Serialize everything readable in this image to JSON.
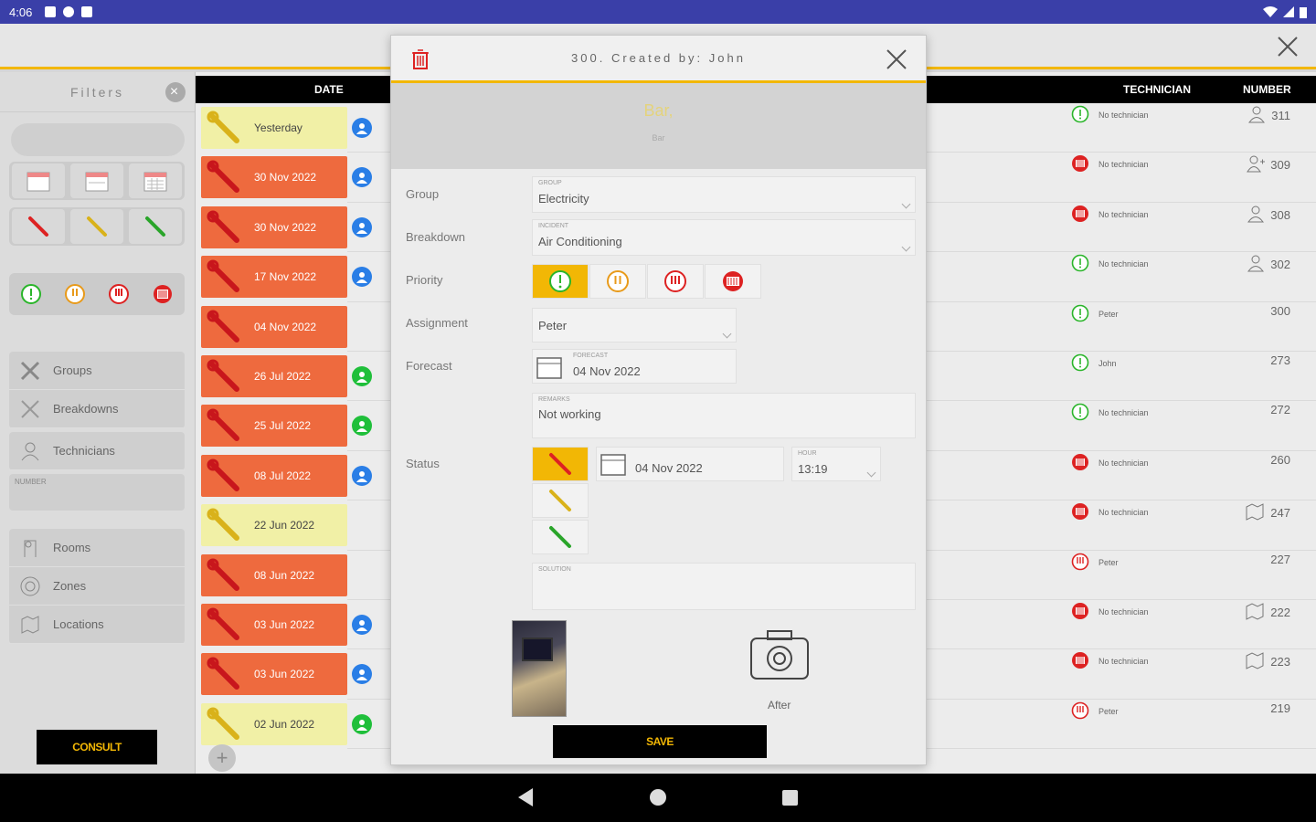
{
  "status_bar": {
    "time": "4:06"
  },
  "filters": {
    "title": "Filters",
    "clear_icon": "close-circle-icon",
    "date_tiles": [
      "calendar-day-icon",
      "calendar-week-icon",
      "calendar-month-icon"
    ],
    "status_tiles": [
      "wrench-red-icon",
      "wrench-yellow-icon",
      "wrench-green-icon"
    ],
    "priority_tiles": [
      "priority-low-icon",
      "priority-medium-icon",
      "priority-high-icon",
      "priority-urgent-icon"
    ],
    "menu_a": [
      {
        "label": "Groups",
        "icon": "groups-icon"
      },
      {
        "label": "Breakdowns",
        "icon": "tools-icon"
      }
    ],
    "menu_b": [
      {
        "label": "Technicians",
        "icon": "technicians-icon"
      }
    ],
    "number_label": "NUMBER",
    "menu_c": [
      {
        "label": "Rooms",
        "icon": "room-icon"
      },
      {
        "label": "Zones",
        "icon": "zone-icon"
      },
      {
        "label": "Locations",
        "icon": "location-icon"
      }
    ],
    "consult_label": "CONSULT"
  },
  "table": {
    "headers": {
      "date": "DATE",
      "technician": "TECHNICIAN",
      "number": "NUMBER"
    },
    "rows": [
      {
        "date": "Yesterday",
        "status": "yellow",
        "user": "blue",
        "technician": "No technician",
        "prio": "green",
        "number": "311",
        "num_icon": "person-icon"
      },
      {
        "date": "30 Nov 2022",
        "status": "red",
        "user": "blue",
        "technician": "No technician",
        "prio": "red",
        "number": "309",
        "num_icon": "person-add-icon"
      },
      {
        "date": "30 Nov 2022",
        "status": "red",
        "user": "blue",
        "technician": "No technician",
        "prio": "red",
        "number": "308",
        "num_icon": "person-icon"
      },
      {
        "date": "17 Nov 2022",
        "status": "red",
        "user": "blue",
        "technician": "No technician",
        "prio": "green",
        "number": "302",
        "num_icon": "person-icon"
      },
      {
        "date": "04 Nov 2022",
        "status": "red",
        "user": "",
        "technician": "Peter",
        "prio": "green",
        "number": "300",
        "num_icon": ""
      },
      {
        "date": "26 Jul 2022",
        "status": "red",
        "user": "green",
        "technician": "John",
        "prio": "green",
        "number": "273",
        "num_icon": ""
      },
      {
        "date": "25 Jul 2022",
        "status": "red",
        "user": "green",
        "technician": "No technician",
        "prio": "green",
        "number": "272",
        "num_icon": ""
      },
      {
        "date": "08 Jul 2022",
        "status": "red",
        "user": "blue",
        "technician": "No technician",
        "prio": "red",
        "number": "260",
        "num_icon": ""
      },
      {
        "date": "22 Jun 2022",
        "status": "yellow",
        "user": "",
        "technician": "No technician",
        "prio": "red",
        "number": "247",
        "num_icon": "location-icon"
      },
      {
        "date": "08 Jun 2022",
        "status": "red",
        "user": "",
        "technician": "Peter",
        "prio": "redo",
        "number": "227",
        "num_icon": ""
      },
      {
        "date": "03 Jun 2022",
        "status": "red",
        "user": "blue",
        "technician": "No technician",
        "prio": "red",
        "number": "222",
        "num_icon": "location-icon"
      },
      {
        "date": "03 Jun 2022",
        "status": "red",
        "user": "blue",
        "technician": "No technician",
        "prio": "red",
        "number": "223",
        "num_icon": "location-icon"
      },
      {
        "date": "02 Jun 2022",
        "status": "yellow",
        "user": "green",
        "technician": "Peter",
        "prio": "redo",
        "number": "219",
        "num_icon": ""
      }
    ]
  },
  "modal": {
    "title": "300. Created by: John",
    "hero_title": "Bar,",
    "hero_sub": "Bar",
    "group": {
      "label": "Group",
      "small": "GROUP",
      "value": "Electricity"
    },
    "breakdown": {
      "label": "Breakdown",
      "small": "INCIDENT",
      "value": "Air Conditioning"
    },
    "priority": {
      "label": "Priority",
      "selected_index": 0
    },
    "assignment": {
      "label": "Assignment",
      "value": "Peter"
    },
    "forecast": {
      "label": "Forecast",
      "small": "FORECAST",
      "value": "04 Nov 2022"
    },
    "remarks": {
      "small": "REMARKS",
      "value": "Not working"
    },
    "status": {
      "label": "Status",
      "date": "04 Nov 2022",
      "hour_small": "HOUR",
      "hour": "13:19"
    },
    "solution_small": "SOLUTION",
    "after_label": "After",
    "save_label": "SAVE"
  },
  "colors": {
    "accent": "#f2b705",
    "red_row": "#ee6a3e",
    "yellow_row": "#f1f0a6",
    "blue": "#2a7ee6",
    "green": "#1fbf3a",
    "status_bar": "#3a3fa8"
  }
}
